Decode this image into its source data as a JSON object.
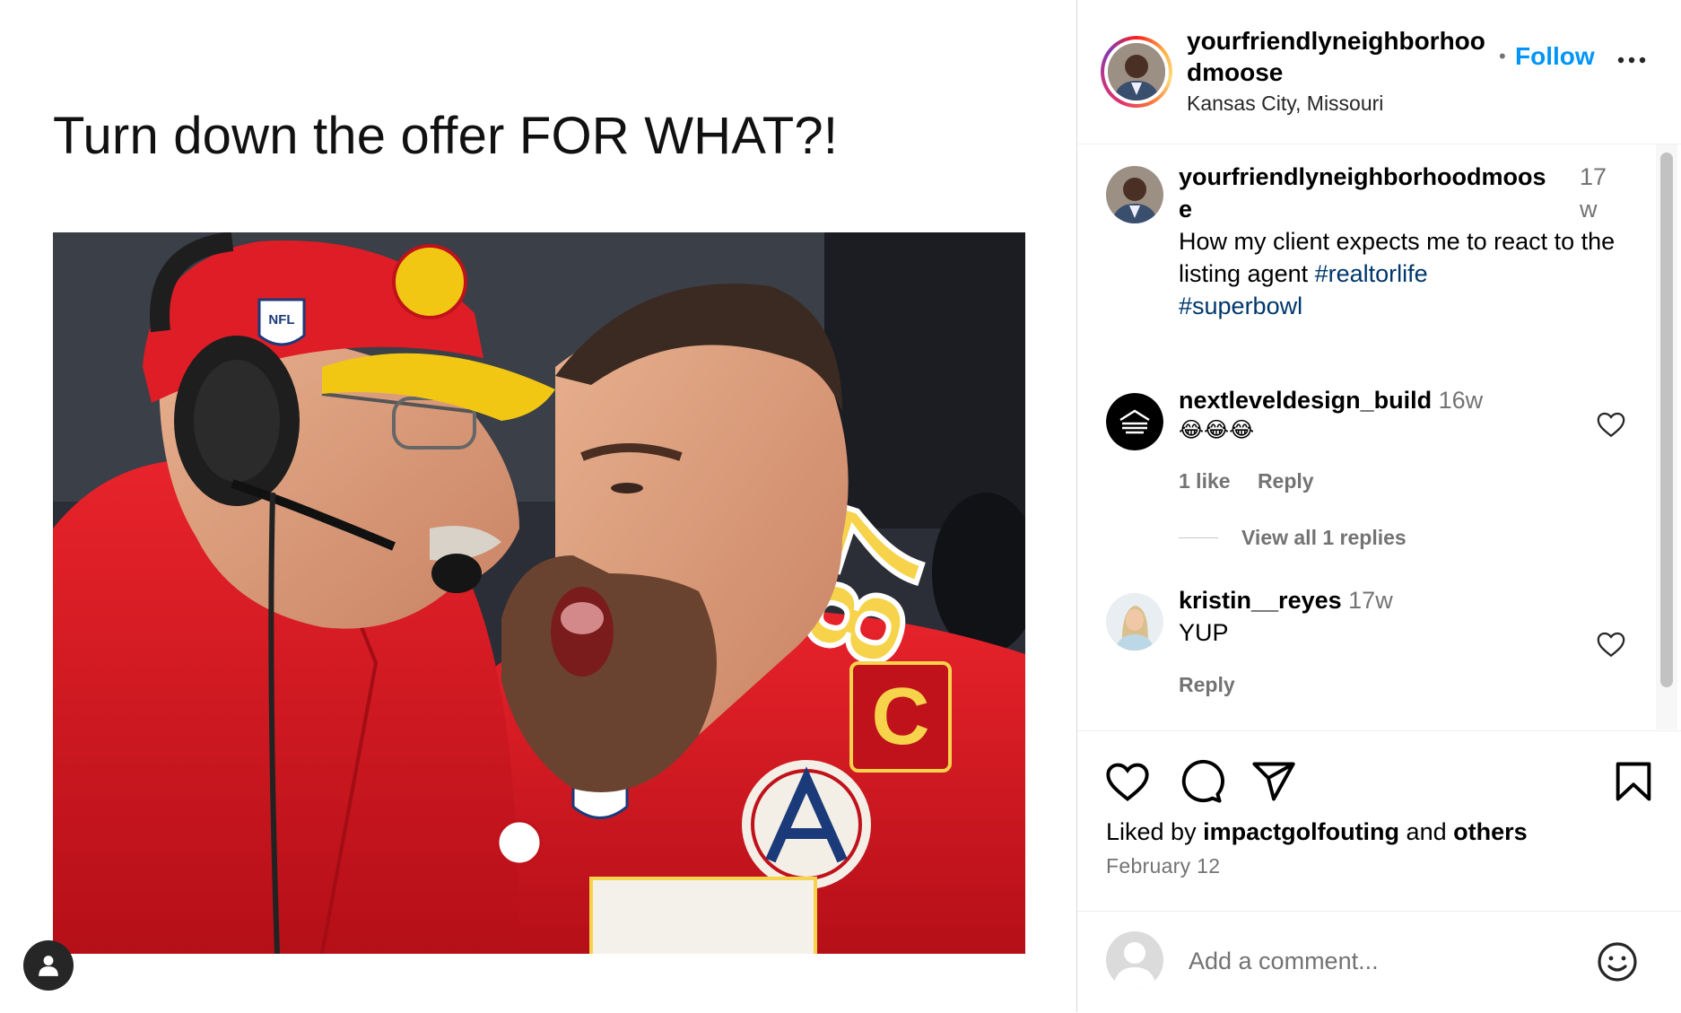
{
  "post": {
    "caption_text": "Turn down the offer FOR WHAT?!",
    "jersey_number": "87",
    "captain_letter": "C",
    "cap_logo_text": "NFL"
  },
  "header": {
    "username": "yourfriendlyneighborhoodmoose",
    "separator": "•",
    "follow_label": "Follow",
    "location": "Kansas City, Missouri"
  },
  "comments": [
    {
      "username": "yourfriendlyneighborhoodmoose",
      "time": "17w",
      "text_before": "How my client expects me to react to the listing agent ",
      "hashtag1": "#realtorlife",
      "hashtag2": "#superbowl"
    },
    {
      "username": "nextleveldesign_build",
      "time": "16w",
      "text": "😂😂😂",
      "likes": "1 like",
      "reply_label": "Reply",
      "view_replies": "View all 1 replies"
    },
    {
      "username": "kristin__reyes",
      "time": "17w",
      "text": "YUP",
      "reply_label": "Reply"
    }
  ],
  "actions": {
    "liked_by_prefix": "Liked by ",
    "liked_by_user": "impactgolfouting",
    "liked_by_and": " and ",
    "liked_by_others": "others",
    "date": "February 12"
  },
  "add_comment": {
    "placeholder": "Add a comment..."
  },
  "icons": [
    "user-icon",
    "more-icon",
    "heart-icon",
    "comment-icon",
    "share-icon",
    "bookmark-icon",
    "emoji-icon"
  ],
  "colors": {
    "follow_blue": "#0095f6",
    "hashtag_blue": "#00376b",
    "muted_gray": "#737373",
    "jersey_red": "#d3131e",
    "cap_yellow": "#f2c713"
  }
}
